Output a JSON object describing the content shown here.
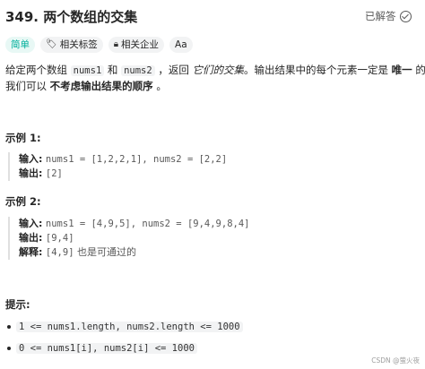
{
  "header": {
    "title": "349. 两个数组的交集",
    "solved_label": "已解答"
  },
  "tags": {
    "difficulty": "简单",
    "topics": "相关标签",
    "companies": "相关企业",
    "font_toggle": "Aa"
  },
  "description": {
    "line1_a": "给定两个数组",
    "nums1": "nums1",
    "and": "和",
    "nums2": "nums2",
    "line1_b": "，返回",
    "intersection": "它们的交集",
    "line1_c": "。输出结果中的每个元素一定是",
    "unique": "唯一",
    "line1_d": "的。",
    "line2_a": "我们可以",
    "any_order": "不考虑输出结果的顺序",
    "line2_b": "。"
  },
  "examples": [
    {
      "heading": "示例 1:",
      "input_label": "输入:",
      "input_value": "nums1 = [1,2,2,1], nums2 = [2,2]",
      "output_label": "输出:",
      "output_value": "[2]"
    },
    {
      "heading": "示例 2:",
      "input_label": "输入:",
      "input_value": "nums1 = [4,9,5], nums2 = [9,4,9,8,4]",
      "output_label": "输出:",
      "output_value": "[9,4]",
      "explain_label": "解释:",
      "explain_value": "[4,9]",
      "explain_text": "也是可通过的"
    }
  ],
  "constraints": {
    "heading": "提示:",
    "items": [
      "1 <= nums1.length, nums2.length <= 1000",
      "0 <= nums1[i], nums2[i] <= 1000"
    ]
  },
  "footer": {
    "watermark": "CSDN @萤火夜"
  },
  "colors": {
    "easy": "#00af9b",
    "tag_bg": "#f2f3f4",
    "text": "#262626"
  }
}
